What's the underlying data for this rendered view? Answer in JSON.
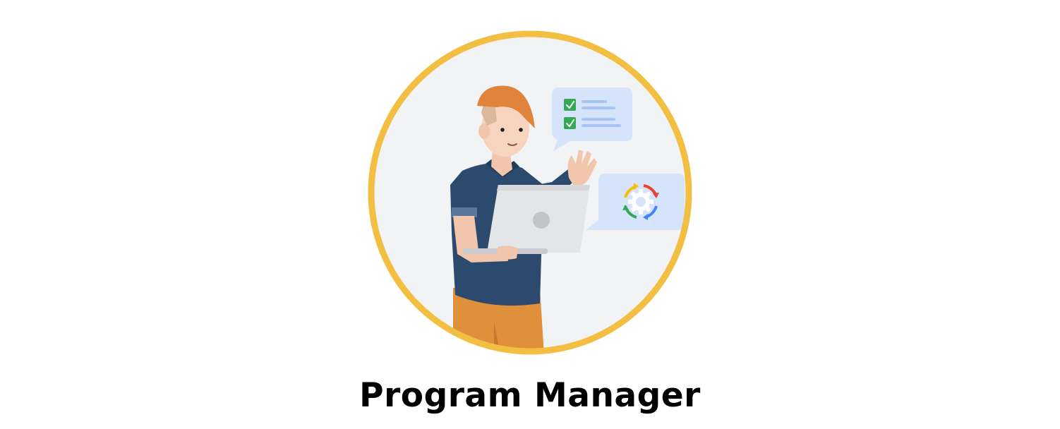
{
  "role": {
    "title": "Program Manager"
  },
  "illustration": {
    "subject": "person-with-laptop",
    "ring_color": "#f2bf42",
    "background_color": "#f1f3f4",
    "icons": [
      "checklist-icon",
      "gear-cycle-icon"
    ],
    "accent_colors": {
      "green": "#34a853",
      "red": "#ea4335",
      "yellow": "#fbbc04",
      "blue": "#4285f4",
      "shirt": "#2b4a6e",
      "hair": "#e0833b",
      "pants": "#e08f3a"
    }
  }
}
